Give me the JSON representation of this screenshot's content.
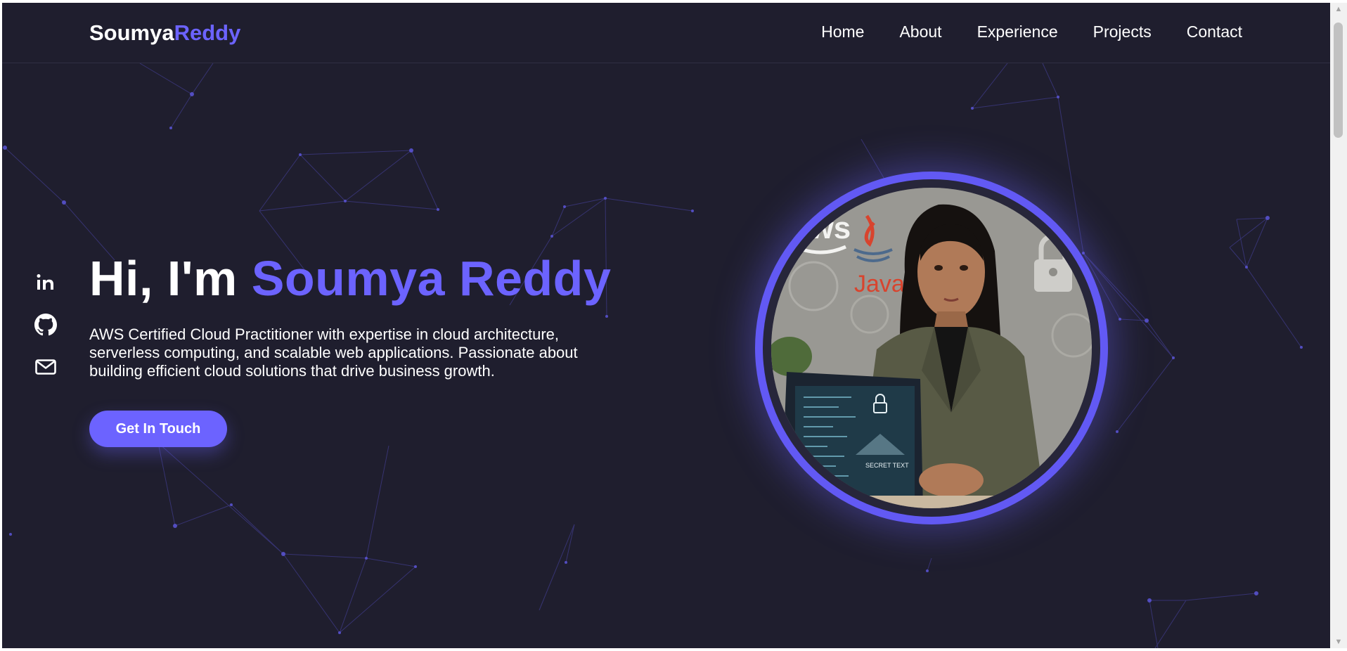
{
  "brand": {
    "first": "Soumya",
    "second": "Reddy"
  },
  "nav": {
    "items": [
      {
        "label": "Home"
      },
      {
        "label": "About"
      },
      {
        "label": "Experience"
      },
      {
        "label": "Projects"
      },
      {
        "label": "Contact"
      }
    ]
  },
  "social": {
    "icons": [
      "linkedin-icon",
      "github-icon",
      "mail-icon"
    ]
  },
  "hero": {
    "greeting": "Hi, I'm ",
    "name": "Soumya Reddy",
    "description": "AWS Certified Cloud Practitioner with expertise in cloud architecture, serverless computing, and scalable web applications. Passionate about building efficient cloud solutions that drive business growth.",
    "cta_label": "Get In Touch"
  },
  "photo": {
    "logo_text": "aws",
    "java_label": "Java",
    "laptop_caption": "SECRET TEXT"
  },
  "colors": {
    "background": "#1f1e2e",
    "accent": "#6c63ff",
    "text": "#ffffff",
    "ring": "#6259f4"
  }
}
